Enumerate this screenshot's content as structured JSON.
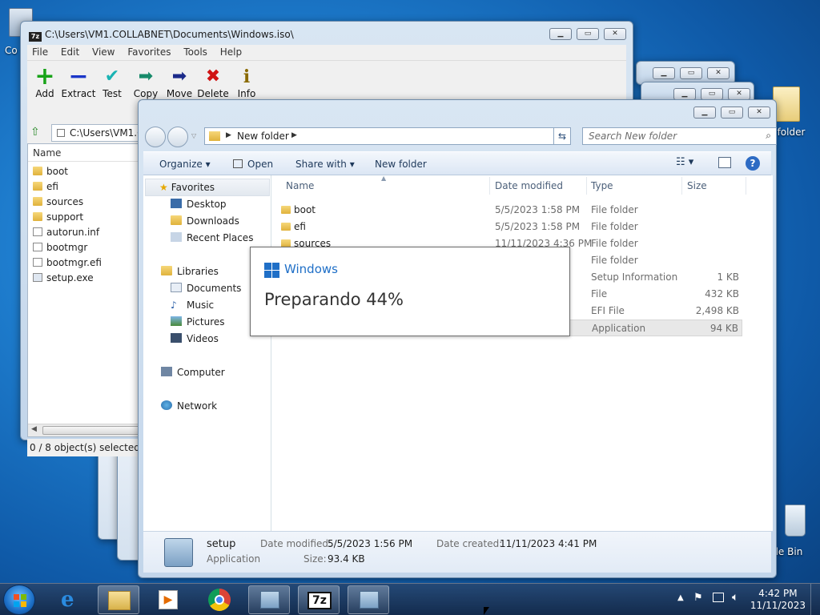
{
  "desktop": {
    "icon_left_label": "Co",
    "icon_right_label": "folder",
    "recycle_label": "cle Bin"
  },
  "sevenzip": {
    "title": "C:\\Users\\VM1.COLLABNET\\Documents\\Windows.iso\\",
    "logo": "7z",
    "menu": [
      "File",
      "Edit",
      "View",
      "Favorites",
      "Tools",
      "Help"
    ],
    "toolbar": {
      "add": "Add",
      "extract": "Extract",
      "test": "Test",
      "copy": "Copy",
      "move": "Move",
      "delete": "Delete",
      "info": "Info"
    },
    "path": "C:\\Users\\VM1.C",
    "list_header": "Name",
    "files": [
      "boot",
      "efi",
      "sources",
      "support",
      "autorun.inf",
      "bootmgr",
      "bootmgr.efi",
      "setup.exe"
    ],
    "status": "0 / 8 object(s) selected"
  },
  "explorer": {
    "address_folder": "New folder",
    "search_placeholder": "Search New folder",
    "commands": {
      "organize": "Organize",
      "open": "Open",
      "share": "Share with",
      "new_folder": "New folder"
    },
    "nav": {
      "favorites": "Favorites",
      "desktop": "Desktop",
      "downloads": "Downloads",
      "recent": "Recent Places",
      "libraries": "Libraries",
      "documents": "Documents",
      "music": "Music",
      "pictures": "Pictures",
      "videos": "Videos",
      "computer": "Computer",
      "network": "Network"
    },
    "columns": {
      "name": "Name",
      "date": "Date modified",
      "type": "Type",
      "size": "Size"
    },
    "rows": [
      {
        "name": "boot",
        "date": "5/5/2023 1:58 PM",
        "type": "File folder",
        "size": ""
      },
      {
        "name": "efi",
        "date": "5/5/2023 1:58 PM",
        "type": "File folder",
        "size": ""
      },
      {
        "name": "sources",
        "date": "11/11/2023 4:36 PM",
        "type": "File folder",
        "size": ""
      },
      {
        "name": "",
        "date": "",
        "type": "File folder",
        "size": ""
      },
      {
        "name": "",
        "date": "",
        "type": "Setup Information",
        "size": "1 KB"
      },
      {
        "name": "",
        "date": "",
        "type": "File",
        "size": "432 KB"
      },
      {
        "name": "",
        "date": "",
        "type": "EFI File",
        "size": "2,498 KB"
      },
      {
        "name": "",
        "date": "",
        "type": "Application",
        "size": "94 KB"
      }
    ],
    "details": {
      "name": "setup",
      "kind": "Application",
      "date_modified_label": "Date modified:",
      "date_modified": "5/5/2023 1:56 PM",
      "size_label": "Size:",
      "size": "93.4 KB",
      "date_created_label": "Date created:",
      "date_created": "11/11/2023 4:41 PM"
    }
  },
  "setup_dialog": {
    "brand": "Windows",
    "message": "Preparando 44%",
    "progress_percent": 44
  },
  "taskbar": {
    "time": "4:42 PM",
    "date": "11/11/2023",
    "zip_label": "7z"
  }
}
